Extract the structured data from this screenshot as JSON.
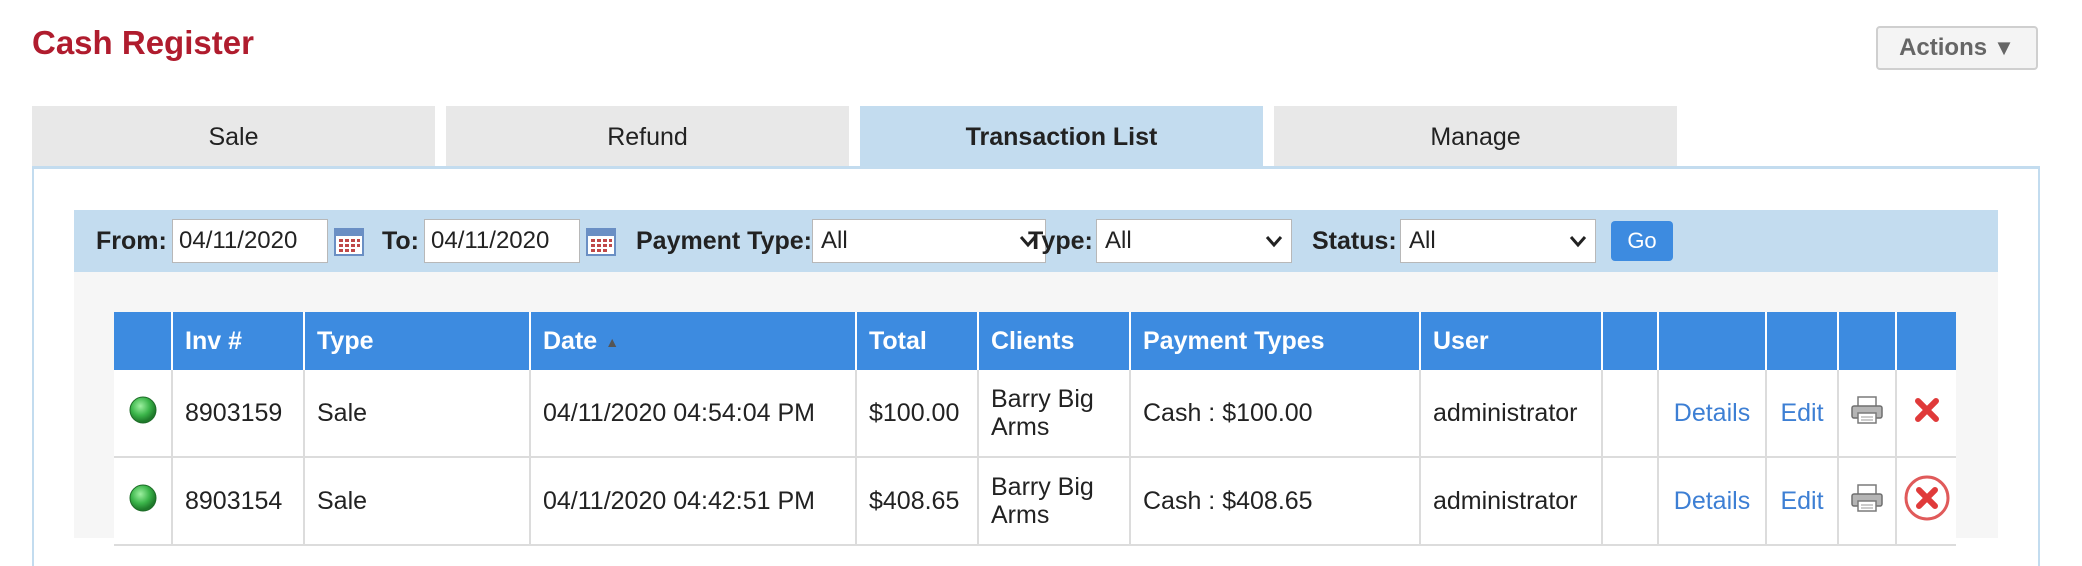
{
  "header": {
    "title": "Cash Register",
    "actions_label": "Actions"
  },
  "tabs": [
    {
      "label": "Sale",
      "active": false
    },
    {
      "label": "Refund",
      "active": false
    },
    {
      "label": "Transaction List",
      "active": true
    },
    {
      "label": "Manage",
      "active": false
    }
  ],
  "filters": {
    "from_label": "From:",
    "from_value": "04/11/2020",
    "to_label": "To:",
    "to_value": "04/11/2020",
    "payment_type_label": "Payment Type:",
    "payment_type_value": "All",
    "type_label": "Type:",
    "type_value": "All",
    "status_label": "Status:",
    "status_value": "All",
    "go_label": "Go"
  },
  "table": {
    "columns": [
      "",
      "Inv #",
      "Type",
      "Date",
      "Total",
      "Clients",
      "Payment Types",
      "User",
      "",
      "",
      "",
      "",
      ""
    ],
    "sorted_column": "Date",
    "rows": [
      {
        "status": "green",
        "inv": "8903159",
        "type": "Sale",
        "date": "04/11/2020 04:54:04 PM",
        "total": "$100.00",
        "client": "Barry Big Arms",
        "payment": "Cash : $100.00",
        "user": "administrator",
        "details": "Details",
        "edit": "Edit"
      },
      {
        "status": "green",
        "inv": "8903154",
        "type": "Sale",
        "date": "04/11/2020 04:42:51 PM",
        "total": "$408.65",
        "client": "Barry Big Arms",
        "payment": "Cash : $408.65",
        "user": "administrator",
        "details": "Details",
        "edit": "Edit"
      }
    ]
  },
  "colors": {
    "title": "#b01c2e",
    "header_blue": "#3d8be0",
    "tab_active": "#c3dcef",
    "link": "#3d7fd4",
    "delete_red": "#e03a3a",
    "status_green": "#3bb54a"
  }
}
